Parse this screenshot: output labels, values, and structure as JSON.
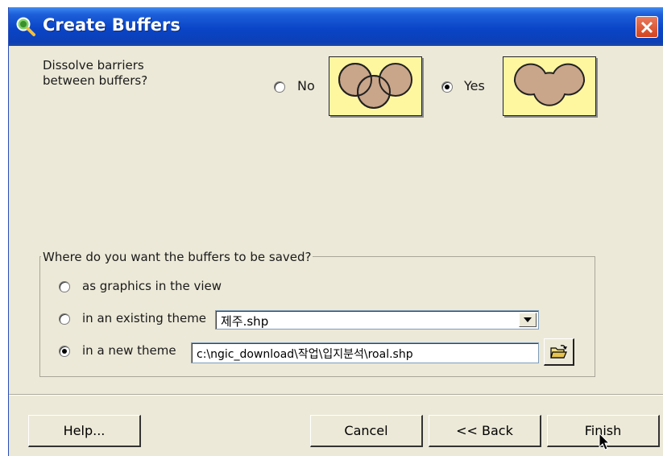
{
  "window": {
    "title": "Create Buffers",
    "title_icon": "magnifier-globe-icon"
  },
  "dissolve": {
    "label": "Dissolve barriers\nbetween buffers?",
    "no_label": "No",
    "yes_label": "Yes",
    "selected": "Yes",
    "thumb_fill": "#fff7a0",
    "buffer_color": "#c9a58a"
  },
  "save": {
    "group_label": "Where do you want the buffers to be saved?",
    "options": [
      {
        "label": "as graphics in the view",
        "checked": false
      },
      {
        "label": "in an existing theme",
        "checked": false
      },
      {
        "label": "in a new theme",
        "checked": true
      }
    ],
    "existing_theme_value": "제주.shp",
    "new_theme_path": "c:\\ngic_download\\작업\\입지분석\\roal.shp"
  },
  "buttons": {
    "help": "Help...",
    "cancel": "Cancel",
    "back": "<< Back",
    "finish": "Finish"
  }
}
